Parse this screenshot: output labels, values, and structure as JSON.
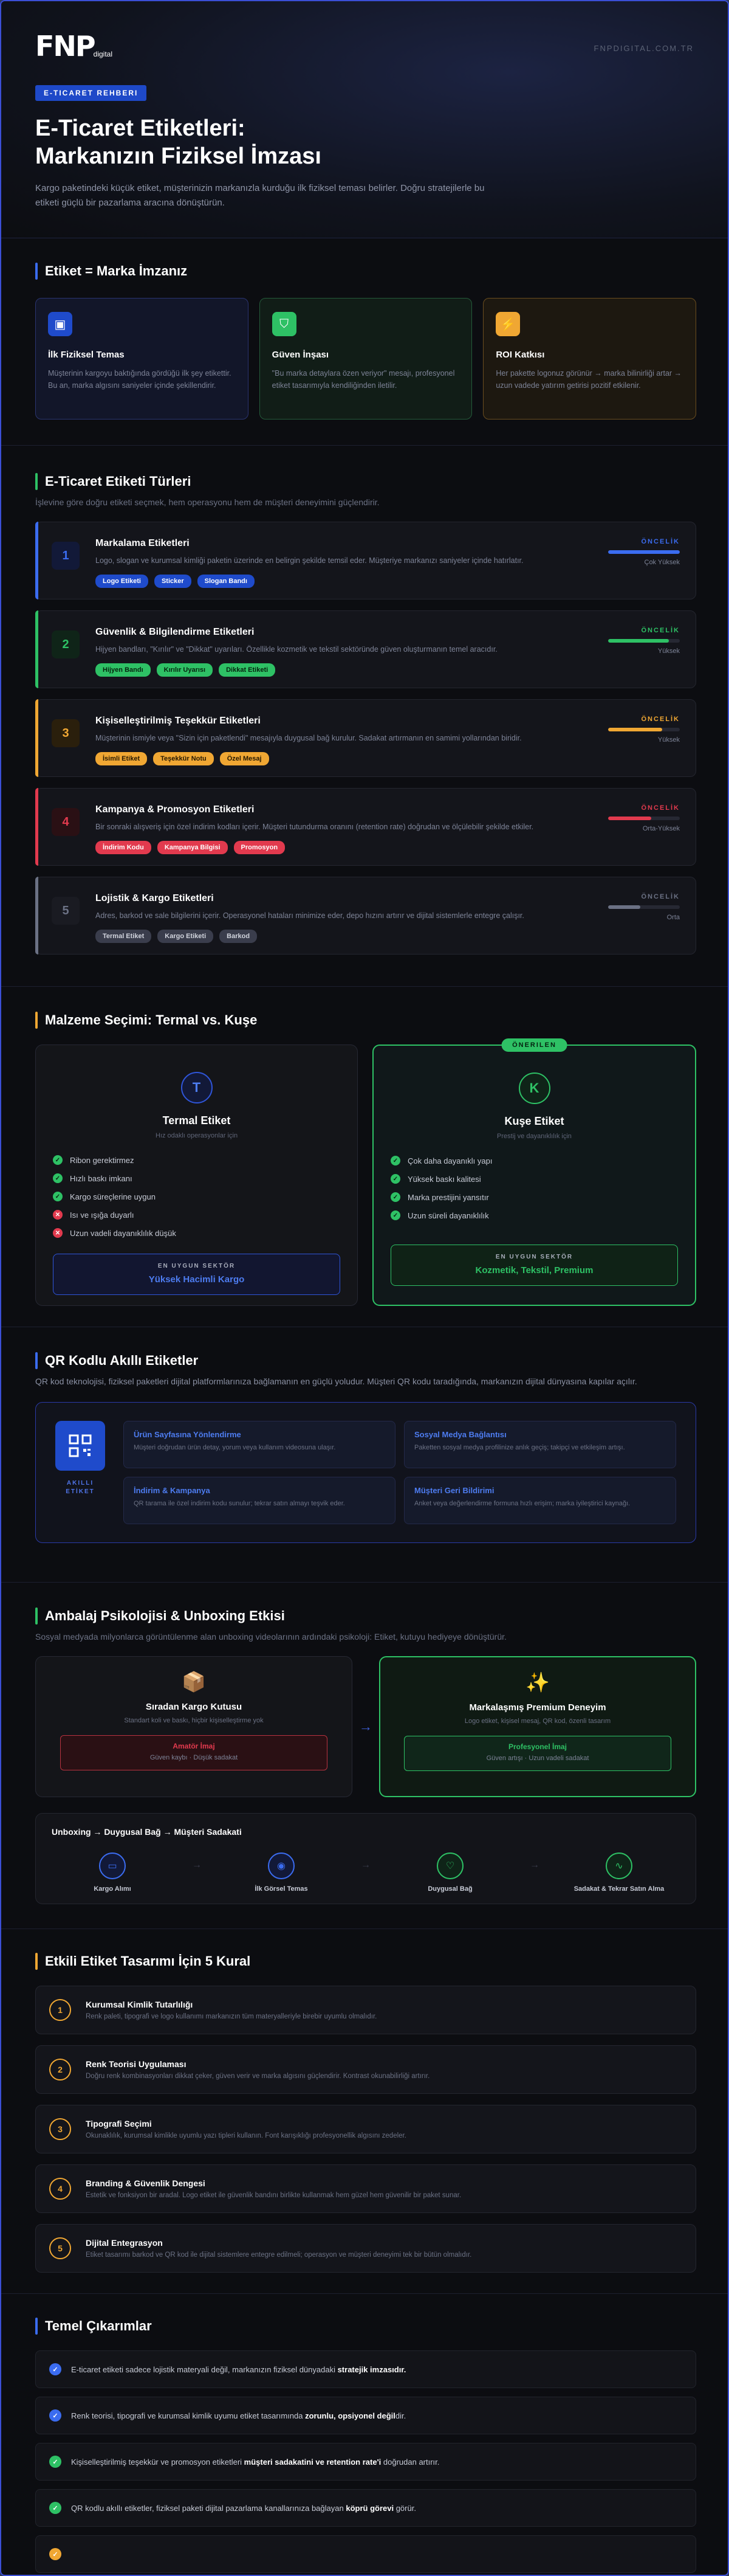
{
  "brand": {
    "logo": "FNP",
    "logo_sub": "digital",
    "url": "FNPDIGITAL.COM.TR"
  },
  "hero": {
    "badge": "E-TICARET REHBERI",
    "title_l1": "E-Ticaret Etiketleri:",
    "title_l2": "Markanızın Fiziksel İmzası",
    "desc": "Kargo paketindeki küçük etiket, müşterinizin markanızla kurduğu ilk fiziksel teması belirler. Doğru stratejilerle bu etiketi güçlü bir pazarlama aracına dönüştürün."
  },
  "s1": {
    "title": "Etiket = Marka İmzanız",
    "cards": [
      {
        "icon": "▣",
        "title": "İlk Fiziksel Temas",
        "text": "Müşterinin kargoyu baktığında gördüğü ilk şey etikettir. Bu an, marka algısını saniyeler içinde şekillendirir."
      },
      {
        "icon": "⛉",
        "title": "Güven İnşası",
        "text": "\"Bu marka detaylara özen veriyor\" mesajı, profesyonel etiket tasarımıyla kendiliğinden iletilir."
      },
      {
        "icon": "⚡",
        "title": "ROI Katkısı",
        "text": "Her pakette logonuz görünür → marka bilinirliği artar → uzun vadede yatırım getirisi pozitif etkilenir."
      }
    ]
  },
  "s2": {
    "title": "E-Ticaret Etiketi Türleri",
    "sub": "İşlevine göre doğru etiketi seçmek, hem operasyonu hem de müşteri deneyimini güçlendirir.",
    "priority_label": "ÖNCELİK",
    "items": [
      {
        "num": "1",
        "title": "Markalama Etiketleri",
        "text": "Logo, slogan ve kurumsal kimliği paketin üzerinde en belirgin şekilde temsil eder. Müşteriye markanızı saniyeler içinde hatırlatır.",
        "tags": [
          "Logo Etiketi",
          "Sticker",
          "Slogan Bandı"
        ],
        "priority": "Çok Yüksek",
        "level": 1.0
      },
      {
        "num": "2",
        "title": "Güvenlik & Bilgilendirme Etiketleri",
        "text": "Hijyen bandları, \"Kırılır\" ve \"Dikkat\" uyarıları. Özellikle kozmetik ve tekstil sektöründe güven oluşturmanın temel aracıdır.",
        "tags": [
          "Hijyen Bandı",
          "Kırılır Uyarısı",
          "Dikkat Etiketi"
        ],
        "priority": "Yüksek",
        "level": 0.85
      },
      {
        "num": "3",
        "title": "Kişiselleştirilmiş Teşekkür Etiketleri",
        "text": "Müşterinin ismiyle veya \"Sizin için paketlendi\" mesajıyla duygusal bağ kurulur. Sadakat artırmanın en samimi yollarından biridir.",
        "tags": [
          "İsimli Etiket",
          "Teşekkür Notu",
          "Özel Mesaj"
        ],
        "priority": "Yüksek",
        "level": 0.75
      },
      {
        "num": "4",
        "title": "Kampanya & Promosyon Etiketleri",
        "text": "Bir sonraki alışveriş için özel indirim kodları içerir. Müşteri tutundurma oranını (retention rate) doğrudan ve ölçülebilir şekilde etkiler.",
        "tags": [
          "İndirim Kodu",
          "Kampanya Bilgisi",
          "Promosyon"
        ],
        "priority": "Orta-Yüksek",
        "level": 0.6
      },
      {
        "num": "5",
        "title": "Lojistik & Kargo Etiketleri",
        "text": "Adres, barkod ve sale bilgilerini içerir. Operasyonel hataları minimize eder, depo hızını artırır ve dijital sistemlerle entegre çalışır.",
        "tags": [
          "Termal Etiket",
          "Kargo Etiketi",
          "Barkod"
        ],
        "priority": "Orta",
        "level": 0.45
      }
    ]
  },
  "s3": {
    "title": "Malzeme Seçimi: Termal vs. Kuşe",
    "thermal": {
      "letter": "T",
      "title": "Termal Etiket",
      "sub": "Hız odaklı operasyonlar için",
      "feats": [
        {
          "t": "Ribon gerektirmez",
          "ok": true
        },
        {
          "t": "Hızlı baskı imkanı",
          "ok": true
        },
        {
          "t": "Kargo süreçlerine uygun",
          "ok": true
        },
        {
          "t": "Isı ve ışığa duyarlı",
          "ok": false
        },
        {
          "t": "Uzun vadeli dayanıklılık düşük",
          "ok": false
        }
      ],
      "best_label": "EN UYGUN SEKTÖR",
      "best": "Yüksek Hacimli Kargo"
    },
    "kuse": {
      "badge": "ÖNERILEN",
      "letter": "K",
      "title": "Kuşe Etiket",
      "sub": "Prestij ve dayanıklılık için",
      "feats": [
        {
          "t": "Çok daha dayanıklı yapı",
          "ok": true
        },
        {
          "t": "Yüksek baskı kalitesi",
          "ok": true
        },
        {
          "t": "Marka prestijini yansıtır",
          "ok": true
        },
        {
          "t": "Uzun süreli dayanıklılık",
          "ok": true
        }
      ],
      "best_label": "EN UYGUN SEKTÖR",
      "best": "Kozmetik, Tekstil, Premium"
    }
  },
  "s4": {
    "title": "QR Kodlu Akıllı Etiketler",
    "sub": "QR kod teknolojisi, fiziksel paketleri dijital platformlarınıza bağlamanın en güçlü yoludur. Müşteri QR kodu taradığında, markanızın dijital dünyasına kapılar açılır.",
    "label_l1": "AKILLI",
    "label_l2": "ETİKET",
    "cells": [
      {
        "t": "Ürün Sayfasına Yönlendirme",
        "d": "Müşteri doğrudan ürün detay, yorum veya kullanım videosuna ulaşır."
      },
      {
        "t": "Sosyal Medya Bağlantısı",
        "d": "Paketten sosyal medya profilinize anlık geçiş; takipçi ve etkileşim artışı."
      },
      {
        "t": "İndirim & Kampanya",
        "d": "QR tarama ile özel indirim kodu sunulur; tekrar satın almayı teşvik eder."
      },
      {
        "t": "Müşteri Geri Bildirimi",
        "d": "Anket veya değerlendirme formuna hızlı erişim; marka iyileştirici kaynağı."
      }
    ]
  },
  "s5": {
    "title": "Ambalaj Psikolojisi & Unboxing Etkisi",
    "sub": "Sosyal medyada milyonlarca görüntülenme alan unboxing videolarının ardındaki psikoloji: Etiket, kutuyu hediyeye dönüştürür.",
    "plain": {
      "icon": "📦",
      "title": "Sıradan Kargo Kutusu",
      "desc": "Standart koli ve baskı, hiçbir kişiselleştirme yok",
      "res": "Amatör İmaj",
      "resd": "Güven kaybı · Düşük sadakat"
    },
    "premium": {
      "icon": "✨",
      "title": "Markalaşmış Premium Deneyim",
      "desc": "Logo etiket, kişisel mesaj, QR kod, özenli tasarım",
      "res": "Profesyonel İmaj",
      "resd": "Güven artışı · Uzun vadeli sadakat"
    },
    "flow_title": "Unboxing → Duygusal Bağ → Müşteri Sadakati",
    "steps": [
      {
        "i": "▭",
        "t": "Kargo Alımı"
      },
      {
        "i": "◉",
        "t": "İlk Görsel Temas"
      },
      {
        "i": "♡",
        "t": "Duygusal Bağ"
      },
      {
        "i": "∿",
        "t": "Sadakat & Tekrar Satın Alma"
      }
    ]
  },
  "s6": {
    "title": "Etkili Etiket Tasarımı İçin 5 Kural",
    "rules": [
      {
        "n": "1",
        "t": "Kurumsal Kimlik Tutarlılığı",
        "d": "Renk paleti, tipografi ve logo kullanımı markanızın tüm materyalleriyle birebir uyumlu olmalıdır."
      },
      {
        "n": "2",
        "t": "Renk Teorisi Uygulaması",
        "d": "Doğru renk kombinasyonları dikkat çeker, güven verir ve marka algısını güçlendirir. Kontrast okunabilirliği artırır."
      },
      {
        "n": "3",
        "t": "Tipografi Seçimi",
        "d": "Okunaklılık, kurumsal kimlikle uyumlu yazı tipleri kullanın. Font karışıklığı profesyonellik algısını zedeler."
      },
      {
        "n": "4",
        "t": "Branding & Güvenlik Dengesi",
        "d": "Estetik ve fonksiyon bir aradal. Logo etiket ile güvenlik bandını birlikte kullanmak hem güzel hem güvenilir bir paket sunar."
      },
      {
        "n": "5",
        "t": "Dijital Entegrasyon",
        "d": "Etiket tasarımı barkod ve QR kod ile dijital sistemlere entegre edilmeli; operasyon ve müşteri deneyimi tek bir bütün olmalıdır."
      }
    ]
  },
  "s7": {
    "title": "Temel Çıkarımlar",
    "items": [
      {
        "pre": "E-ticaret etiketi sadece lojistik materyali değil, markanızın fiziksel dünyadaki ",
        "b": "stratejik imzasıdır.",
        "post": ""
      },
      {
        "pre": "Renk teorisi, tipografi ve kurumsal kimlik uyumu etiket tasarımında ",
        "b": "zorunlu, opsiyonel değil",
        "post": "dir."
      },
      {
        "pre": "Kişiselleştirilmiş teşekkür ve promosyon etiketleri ",
        "b": "müşteri sadakatini ve retention rate'i",
        "post": " doğrudan artırır."
      },
      {
        "pre": "QR kodlu akıllı etiketler, fiziksel paketi dijital pazarlama kanallarınıza bağlayan ",
        "b": "köprü görevi",
        "post": " görür."
      },
      {
        "pre": "",
        "b": "",
        "post": ""
      }
    ]
  },
  "colors": {
    "blue": "#3b6cf0",
    "green": "#2ec165",
    "amber": "#f0a733",
    "red": "#e23a4e",
    "gray": "#6b7184"
  }
}
